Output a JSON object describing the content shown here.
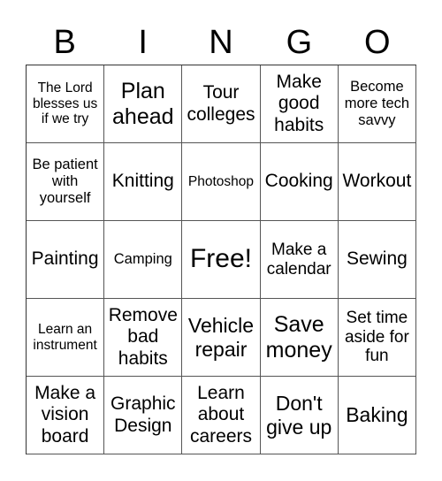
{
  "header": [
    "B",
    "I",
    "N",
    "G",
    "O"
  ],
  "cells": [
    [
      "The Lord blesses us if we try",
      "Plan ahead",
      "Tour colleges",
      "Make good habits",
      "Become more tech savvy"
    ],
    [
      "Be patient with yourself",
      "Knitting",
      "Photoshop",
      "Cooking",
      "Workout"
    ],
    [
      "Painting",
      "Camping",
      "Free!",
      "Make a calendar",
      "Sewing"
    ],
    [
      "Learn an instrument",
      "Remove bad habits",
      "Vehicle repair",
      "Save money",
      "Set time aside for fun"
    ],
    [
      "Make a vision board",
      "Graphic Design",
      "Learn about careers",
      "Don't give up",
      "Baking"
    ]
  ]
}
